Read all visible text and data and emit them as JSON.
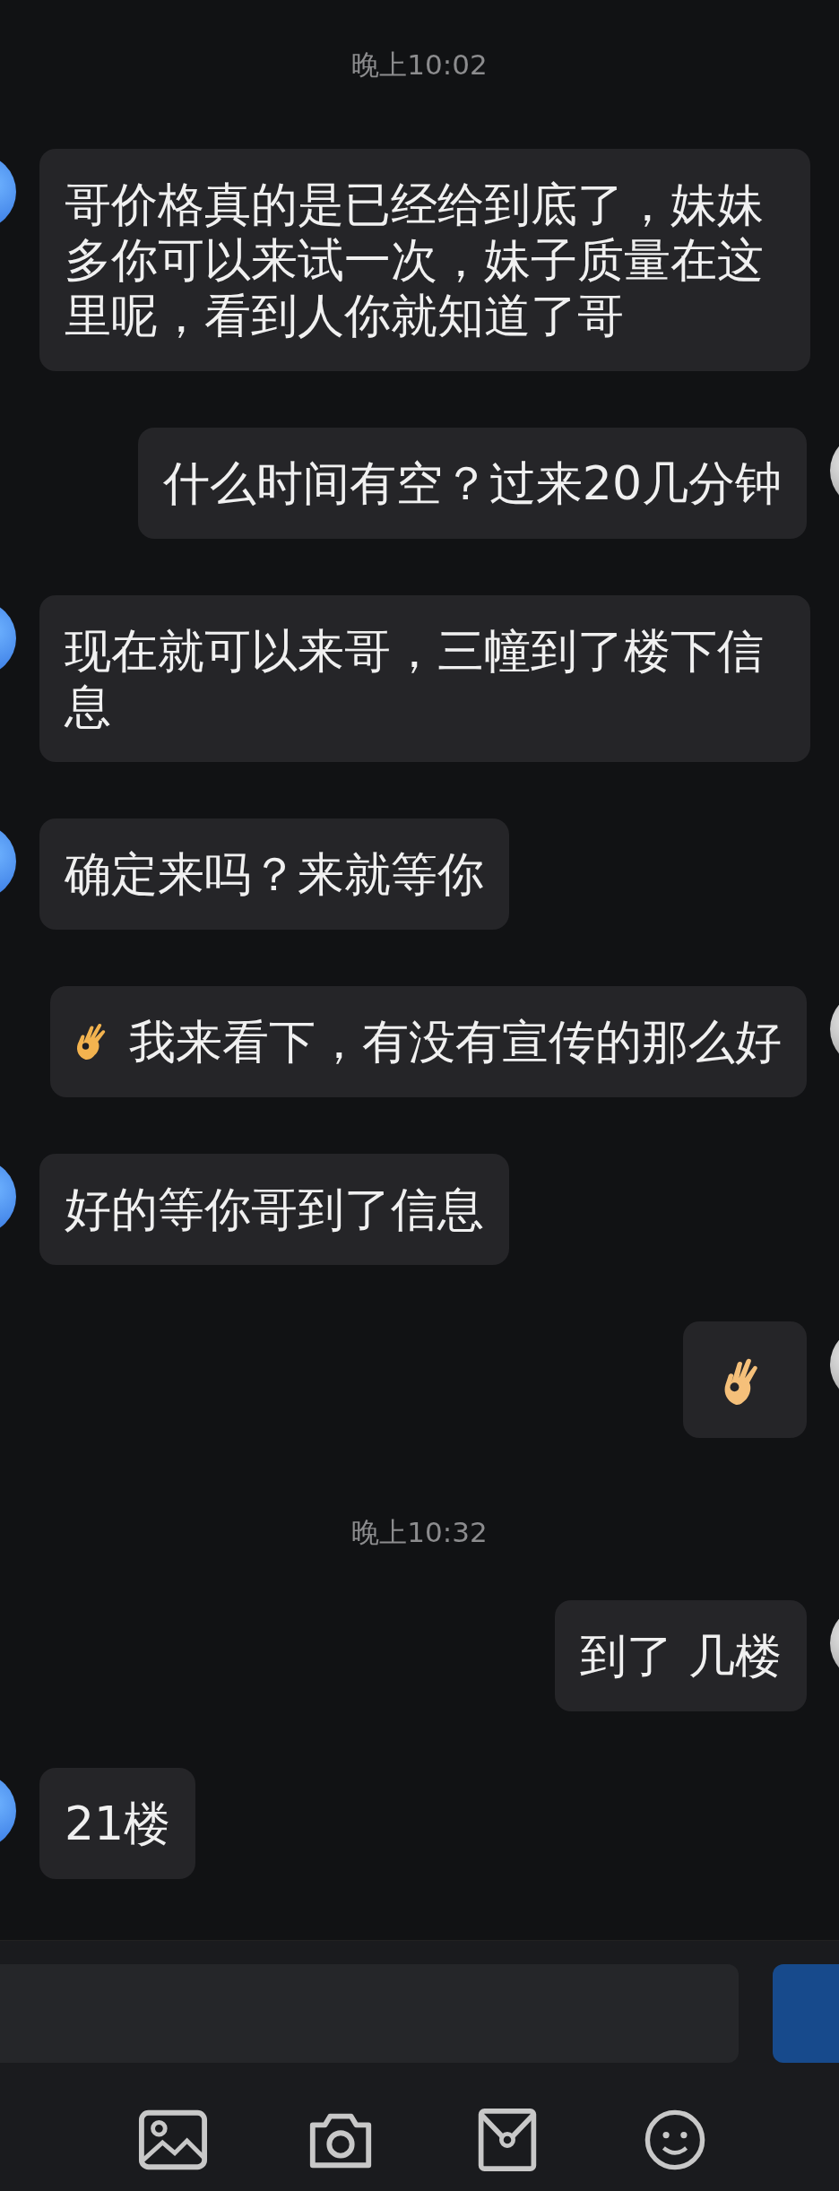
{
  "messages": [
    {
      "kind": "time",
      "text": "晚上10:02"
    },
    {
      "kind": "incoming",
      "text": "哥价格真的是已经给到底了，妹妹多你可以来试一次，妹子质量在这里呢，看到人你就知道了哥"
    },
    {
      "kind": "outgoing",
      "text": "什么时间有空？过来20几分钟"
    },
    {
      "kind": "incoming",
      "text": "现在就可以来哥，三幢到了楼下信息"
    },
    {
      "kind": "incoming",
      "text": "确定来吗？来就等你"
    },
    {
      "kind": "outgoing",
      "emoji_prefix": true,
      "text": "我来看下，有没有宣传的那么好"
    },
    {
      "kind": "incoming",
      "text": "好的等你哥到了信息"
    },
    {
      "kind": "outgoing_emoji"
    },
    {
      "kind": "time",
      "text": "晚上10:32"
    },
    {
      "kind": "outgoing",
      "text": "到了 几楼"
    },
    {
      "kind": "incoming",
      "text": "21楼"
    }
  ],
  "toolbar": [
    {
      "kind": "image"
    },
    {
      "kind": "camera"
    },
    {
      "kind": "envelope"
    },
    {
      "kind": "smiley"
    }
  ]
}
